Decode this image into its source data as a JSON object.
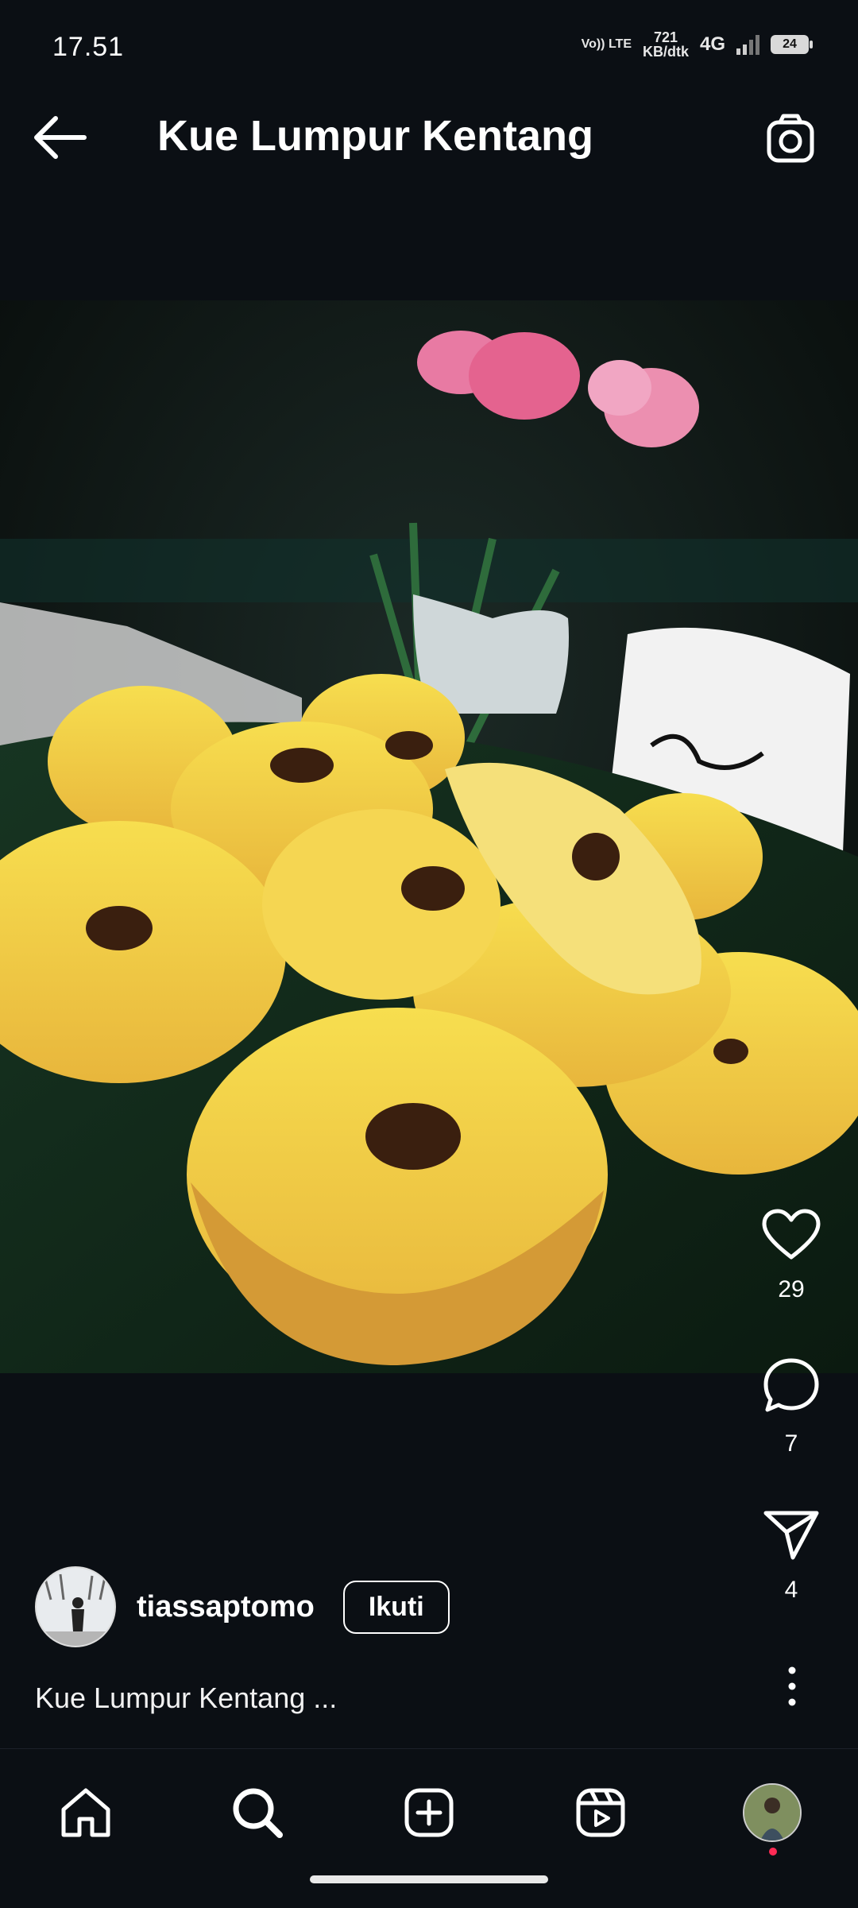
{
  "status_bar": {
    "time": "17.51",
    "volte_label": "Vo)) LTE",
    "speed_value": "721",
    "speed_unit": "KB/dtk",
    "network": "4G",
    "battery": "24"
  },
  "header": {
    "title": "Kue Lumpur Kentang"
  },
  "post": {
    "image_icon": "food-photo",
    "actions": {
      "like_count": "29",
      "comment_count": "7",
      "share_count": "4"
    },
    "author": {
      "username": "tiassaptomo",
      "follow_label": "Ikuti"
    },
    "caption": "Kue Lumpur Kentang ..."
  },
  "bottom_nav": {
    "items": [
      "home-icon",
      "search-icon",
      "create-icon",
      "reels-icon",
      "profile-avatar"
    ]
  }
}
